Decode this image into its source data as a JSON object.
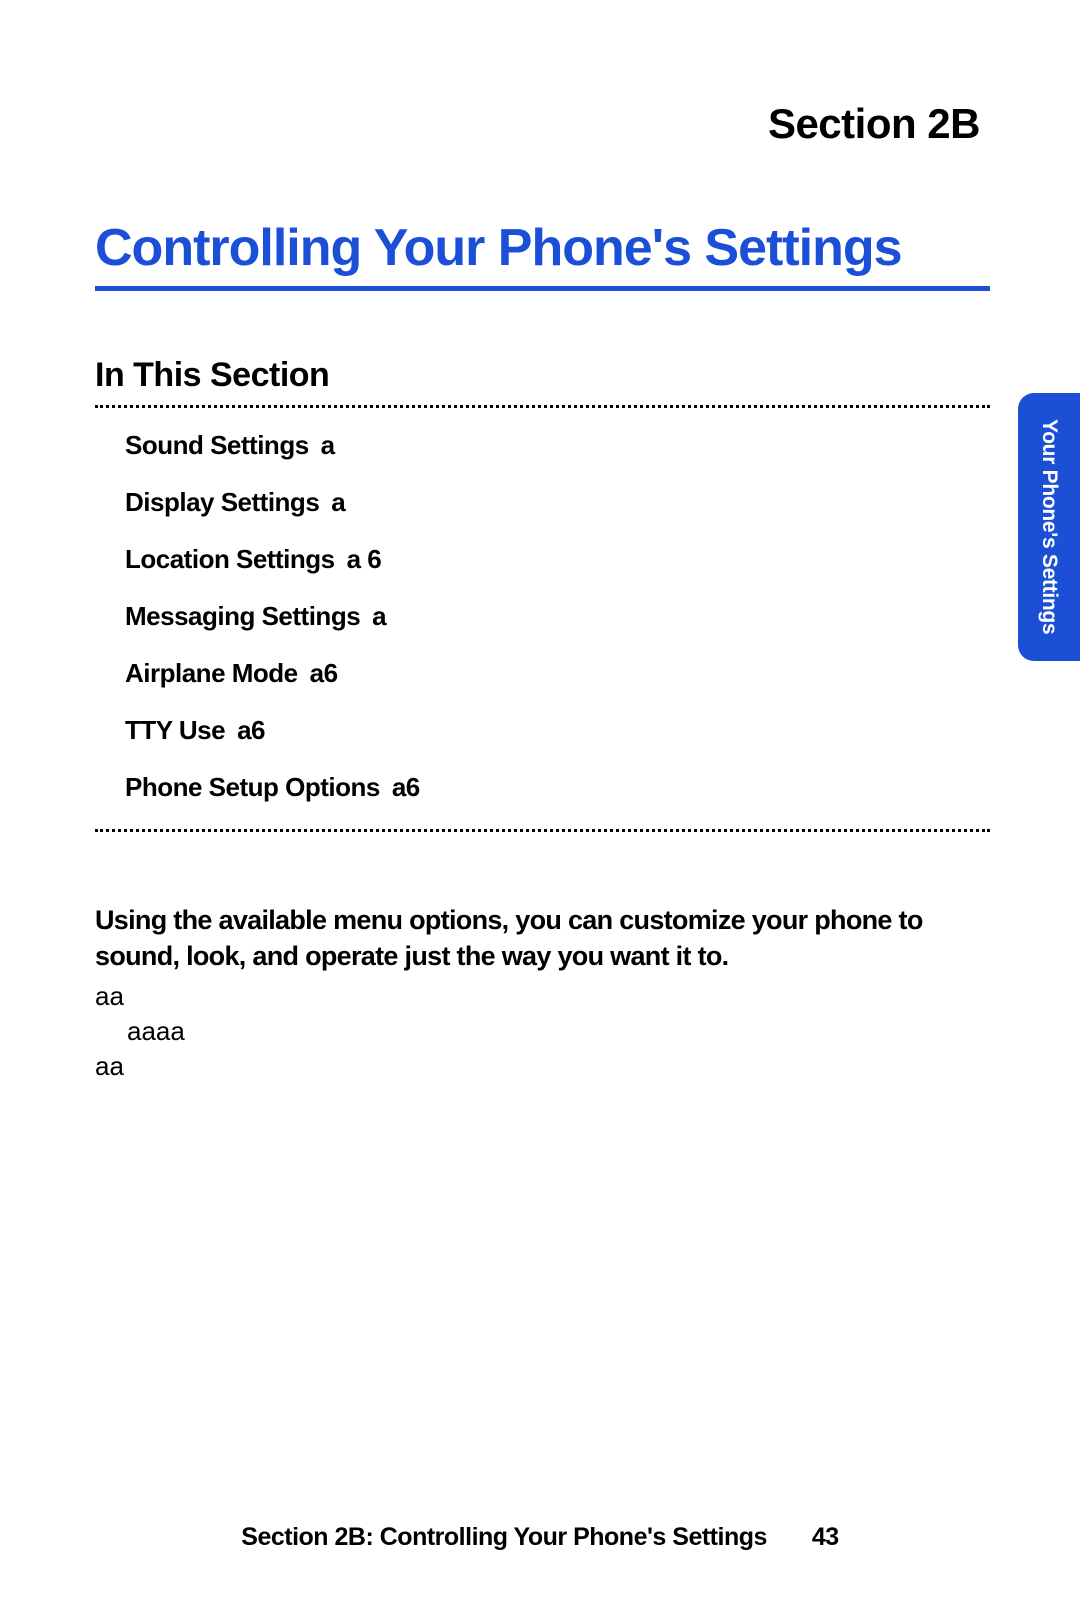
{
  "header": {
    "section_label": "Section 2B"
  },
  "title": "Controlling Your Phone's Settings",
  "subsection_heading": "In This Section",
  "toc": [
    {
      "label": "Sound Settings",
      "suffix": "a"
    },
    {
      "label": "Display Settings",
      "suffix": "a"
    },
    {
      "label": "Location Settings",
      "suffix": "a  6"
    },
    {
      "label": "Messaging Settings",
      "suffix": "a"
    },
    {
      "label": "Airplane Mode",
      "suffix": "a6"
    },
    {
      "label": "TTY Use",
      "suffix": "a6"
    },
    {
      "label": "Phone Setup Options",
      "suffix": "a6"
    }
  ],
  "body": {
    "intro": "Using the available menu options, you can customize your phone to sound, look, and operate just the way you want it to.",
    "extra_lines": [
      {
        "text": "aa",
        "indent": false
      },
      {
        "text": "aaaa",
        "indent": true
      },
      {
        "text": "aa",
        "indent": false
      }
    ]
  },
  "side_tab": "Your Phone's Settings",
  "footer": {
    "text": "Section 2B: Controlling Your Phone's Settings",
    "page": "43"
  }
}
